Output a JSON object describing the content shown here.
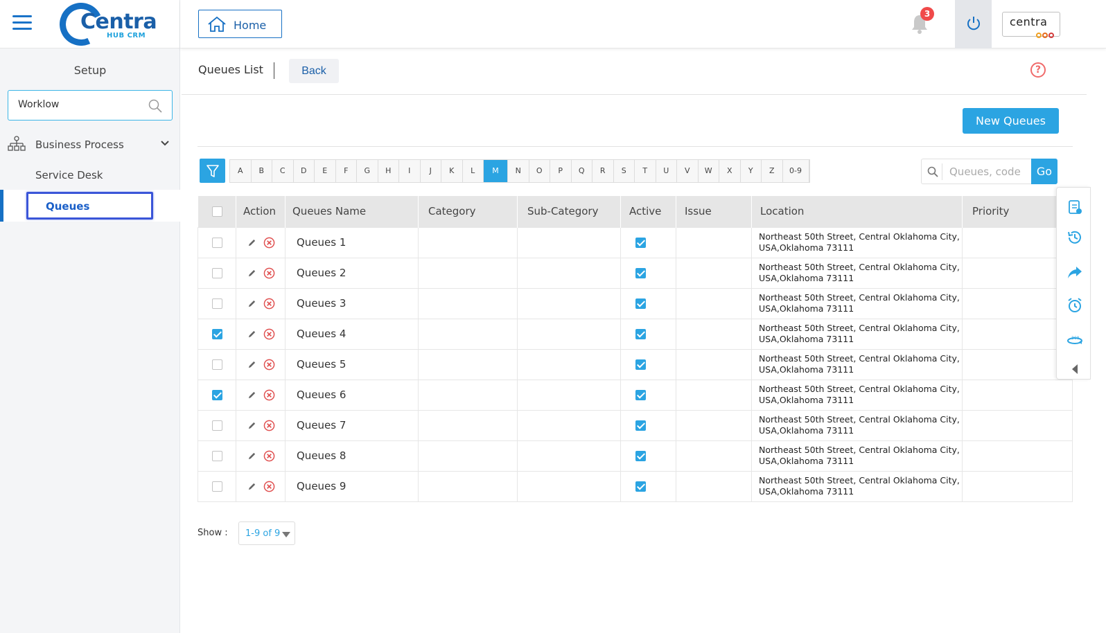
{
  "sidebar": {
    "setup_title": "Setup",
    "search_value": "Worklow",
    "business_process_label": "Business Process",
    "service_desk_label": "Service Desk",
    "queues_label": "Queues"
  },
  "brand": {
    "logo_text": "Centra",
    "logo_sub": "HUB CRM",
    "right_brand": "centra"
  },
  "topbar": {
    "home_label": "Home",
    "notification_count": "3"
  },
  "page": {
    "title": "Queues List",
    "back_label": "Back",
    "help_symbol": "?",
    "new_button_label": "New Queues",
    "search_placeholder": "Queues, code",
    "go_label": "Go"
  },
  "alphabet": [
    "A",
    "B",
    "C",
    "D",
    "E",
    "F",
    "G",
    "H",
    "I",
    "J",
    "K",
    "L",
    "M",
    "N",
    "O",
    "P",
    "Q",
    "R",
    "S",
    "T",
    "U",
    "V",
    "W",
    "X",
    "Y",
    "Z",
    "0-9"
  ],
  "alphabet_active": "M",
  "table": {
    "headers": {
      "action": "Action",
      "name": "Queues Name",
      "category": "Category",
      "subcategory": "Sub-Category",
      "active": "Active",
      "issue": "Issue",
      "location": "Location",
      "priority": "Priority"
    },
    "rows": [
      {
        "selected": false,
        "name": "Queues 1",
        "category": "",
        "subcategory": "",
        "active": true,
        "issue": "",
        "location_line1": "Northeast 50th Street, Central Oklahoma City,",
        "location_line2": "USA,Oklahoma 73111",
        "priority": ""
      },
      {
        "selected": false,
        "name": "Queues 2",
        "category": "",
        "subcategory": "",
        "active": true,
        "issue": "",
        "location_line1": "Northeast 50th Street, Central Oklahoma City,",
        "location_line2": "USA,Oklahoma 73111",
        "priority": ""
      },
      {
        "selected": false,
        "name": "Queues 3",
        "category": "",
        "subcategory": "",
        "active": true,
        "issue": "",
        "location_line1": "Northeast 50th Street, Central Oklahoma City,",
        "location_line2": "USA,Oklahoma 73111",
        "priority": ""
      },
      {
        "selected": true,
        "name": "Queues 4",
        "category": "",
        "subcategory": "",
        "active": true,
        "issue": "",
        "location_line1": "Northeast 50th Street, Central Oklahoma City,",
        "location_line2": "USA,Oklahoma 73111",
        "priority": ""
      },
      {
        "selected": false,
        "name": "Queues 5",
        "category": "",
        "subcategory": "",
        "active": true,
        "issue": "",
        "location_line1": "Northeast 50th Street, Central Oklahoma City,",
        "location_line2": "USA,Oklahoma 73111",
        "priority": ""
      },
      {
        "selected": true,
        "name": "Queues 6",
        "category": "",
        "subcategory": "",
        "active": true,
        "issue": "",
        "location_line1": "Northeast 50th Street, Central Oklahoma City,",
        "location_line2": "USA,Oklahoma 73111",
        "priority": ""
      },
      {
        "selected": false,
        "name": "Queues 7",
        "category": "",
        "subcategory": "",
        "active": true,
        "issue": "",
        "location_line1": "Northeast 50th Street, Central Oklahoma City,",
        "location_line2": "USA,Oklahoma 73111",
        "priority": ""
      },
      {
        "selected": false,
        "name": "Queues 8",
        "category": "",
        "subcategory": "",
        "active": true,
        "issue": "",
        "location_line1": "Northeast 50th Street, Central Oklahoma City,",
        "location_line2": "USA,Oklahoma 73111",
        "priority": ""
      },
      {
        "selected": false,
        "name": "Queues 9",
        "category": "",
        "subcategory": "",
        "active": true,
        "issue": "",
        "location_line1": "Northeast 50th Street, Central Oklahoma City,",
        "location_line2": "USA,Oklahoma 73111",
        "priority": ""
      }
    ]
  },
  "pagination": {
    "show_label": "Show :",
    "range_value": "1-9 of 9"
  },
  "icons": {
    "menu": "hamburger-icon",
    "search": "search-icon",
    "business_process": "org-chart-icon",
    "chevron": "chevron-down-icon",
    "home": "home-icon",
    "notifications": "bell-icon",
    "power": "power-icon",
    "filter": "filter-icon",
    "edit": "pencil-icon",
    "delete": "delete-circle-icon",
    "tools": [
      "clipboard-icon",
      "history-icon",
      "share-icon",
      "alarm-icon",
      "view-360-icon",
      "collapse-left-icon"
    ]
  },
  "colors": {
    "accent": "#2ba4e2",
    "brand": "#1670c4",
    "danger": "#e05050",
    "highlight_box": "#3a55d8"
  }
}
